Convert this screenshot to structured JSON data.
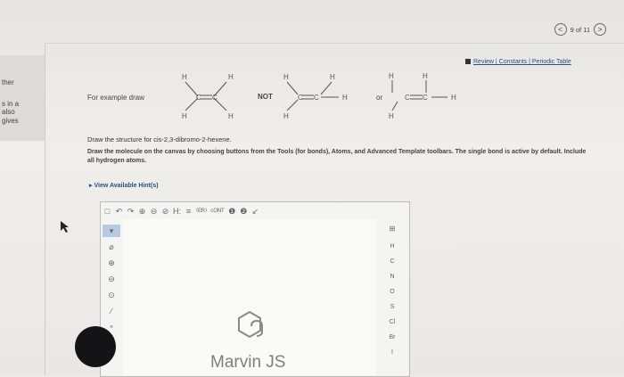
{
  "left_panel": {
    "lines": [
      "ther",
      "s in a",
      "also",
      "gives"
    ]
  },
  "nav": {
    "page": "9 of 11",
    "prev": "<",
    "next": ">"
  },
  "links": {
    "text": "Review | Constants | Periodic Table"
  },
  "example": {
    "prefix": "For example draw",
    "not_label": "NOT",
    "or_label": "or"
  },
  "question": {
    "line1": "Draw the structure for cis-2,3-dibromo-2-hexene.",
    "line2": "Draw the molecule on the canvas by choosing buttons from the Tools (for bonds), Atoms, and Advanced Template toolbars. The single bond is active by default. Include all hydrogen atoms.",
    "hint": "View Available Hint(s)"
  },
  "editor": {
    "top_tools": [
      "□",
      "↶",
      "↷",
      "⊕",
      "⊖",
      "⊘",
      "H:",
      "≡",
      "⁽ᴱᴿ⁾",
      "ᶜᴼᴺᵀ",
      "❶",
      "❷",
      "↙"
    ],
    "left_tools": [
      "▾",
      "⌀",
      "⊕",
      "⊖",
      "⊙",
      "∕",
      "ⁿ",
      "∟"
    ],
    "atoms": [
      "H",
      "C",
      "N",
      "O",
      "S",
      "Cl",
      "Br",
      "I"
    ],
    "logo_text": "Marvin JS"
  }
}
